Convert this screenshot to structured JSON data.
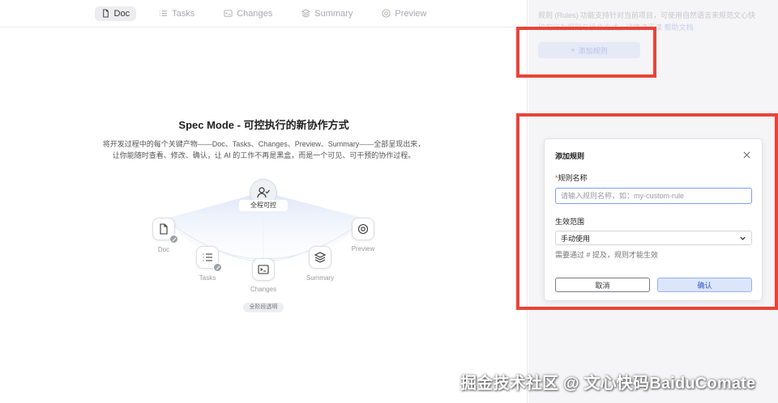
{
  "tabs": [
    {
      "label": "Doc",
      "icon": "doc-icon",
      "active": true
    },
    {
      "label": "Tasks",
      "icon": "list-icon",
      "active": false
    },
    {
      "label": "Changes",
      "icon": "terminal-icon",
      "active": false
    },
    {
      "label": "Summary",
      "icon": "layers-icon",
      "active": false
    },
    {
      "label": "Preview",
      "icon": "globe-icon",
      "active": false
    }
  ],
  "hero": {
    "title": "Spec Mode - 可控执行的新协作方式",
    "desc_line1": "将开发过程中的每个关键产物——Doc、Tasks、Changes、Preview、Summary——全部呈现出来，",
    "desc_line2": "让你能随时查看、修改、确认，让 AI 的工作不再是黑盒，而是一个可见、可干预的协作过程。"
  },
  "diagram": {
    "center_label": "全程可控",
    "bottom_label": "全阶段透明",
    "nodes": {
      "doc": "Doc",
      "tasks": "Tasks",
      "changes": "Changes",
      "summary": "Summary",
      "preview": "Preview"
    }
  },
  "sidebar": {
    "info_line1": "规则 (Rules) 功能支持针对当前项目，可使用自然语言来规范文心快",
    "info_line2": "码的行为规则与操作方式，详情请阅读",
    "help_link": "帮助文档",
    "add_rule_label": "添加规则"
  },
  "dialog": {
    "title": "添加规则",
    "name_label": "规则名称",
    "required_mark": "*",
    "name_placeholder": "请输入规则名称，如：my-custom-rule",
    "scope_label": "生效范围",
    "scope_value": "手动使用",
    "hint": "需要通过 # 提及，规则才能生效",
    "cancel_label": "取消",
    "confirm_label": "确认"
  },
  "watermark": "掘金技术社区 @ 文心快码BaiduComate",
  "colors": {
    "highlight_red": "#e8443a",
    "accent_blue": "#2f56c9",
    "confirm_bg": "#dbe6fb"
  }
}
